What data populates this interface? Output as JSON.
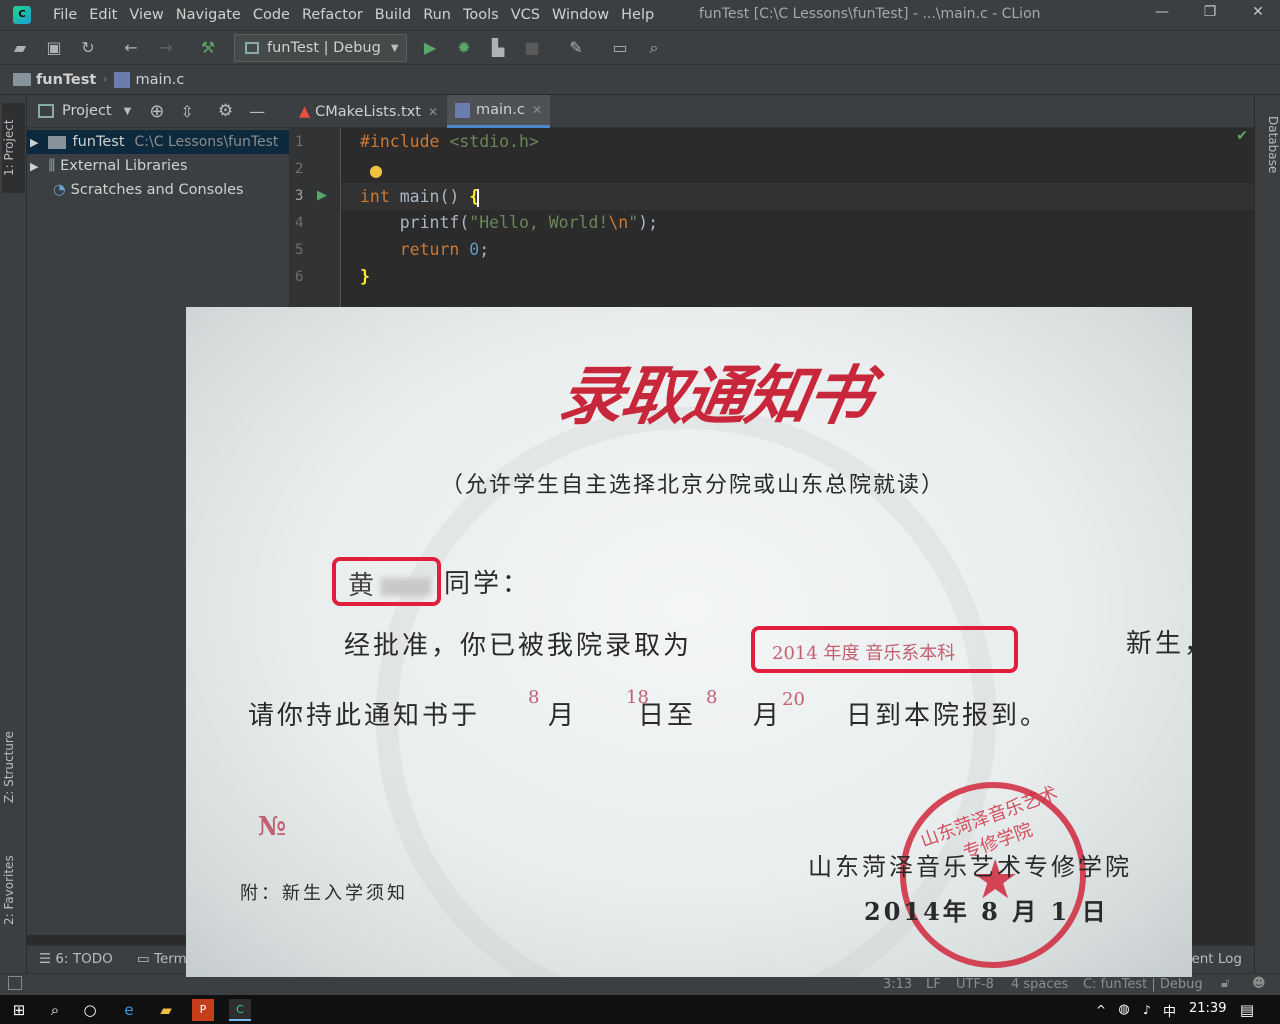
{
  "window": {
    "title": "funTest [C:\\C Lessons\\funTest] - ...\\main.c - CLion",
    "minimize_glyph": "—",
    "restore_glyph": "❐",
    "close_glyph": "✕"
  },
  "menu": [
    "File",
    "Edit",
    "View",
    "Navigate",
    "Code",
    "Refactor",
    "Build",
    "Run",
    "Tools",
    "VCS",
    "Window",
    "Help"
  ],
  "toolbar": {
    "run_config": "funTest | Debug"
  },
  "breadcrumb": {
    "project": "funTest",
    "file": "main.c"
  },
  "project_panel": {
    "view_label": "Project",
    "items": [
      {
        "label": "funTest",
        "path": "C:\\C Lessons\\funTest"
      },
      {
        "label": "External Libraries",
        "path": ""
      },
      {
        "label": "Scratches and Consoles",
        "path": ""
      }
    ]
  },
  "left_tabs": {
    "project": "1: Project",
    "structure": "Z: Structure",
    "favorites": "2: Favorites"
  },
  "right_tabs": {
    "database": "Database"
  },
  "editor": {
    "tabs": [
      {
        "label": "CMakeLists.txt",
        "active": false
      },
      {
        "label": "main.c",
        "active": true
      }
    ],
    "line_numbers": [
      "1",
      "2",
      "3",
      "4",
      "5",
      "6"
    ],
    "code": {
      "l1_directive": "#include",
      "l1_header": "<stdio.h>",
      "l3_type": "int",
      "l3_rest": " main() ",
      "l3_brace": "{",
      "l4_call": "    printf(",
      "l4_str_a": "\"Hello, World!",
      "l4_esc": "\\n",
      "l4_str_b": "\"",
      "l4_end": ");",
      "l5_kw": "    return",
      "l5_sp": " ",
      "l5_num": "0",
      "l5_end": ";",
      "l6_brace": "}"
    }
  },
  "bottom_tools": {
    "todo": "6: TODO",
    "terminal": "Term",
    "event_log": "ent Log"
  },
  "status": {
    "position": "3:13",
    "line_sep": "LF",
    "encoding": "UTF-8",
    "indent": "4 spaces",
    "context": "C: funTest | Debug"
  },
  "taskbar": {
    "ime": "中",
    "time": "21:39"
  },
  "notice": {
    "title": "录取通知书",
    "subtitle": "（允许学生自主选择北京分院或山东总院就读）",
    "name_prefix": "黄",
    "salutation": "同学：",
    "line1": "经批准，你已被我院录取为",
    "admission": "2014 年度  音乐系本科",
    "line1_tail": "新生，",
    "line2": "请你持此通知书于",
    "m1": "8",
    "month_word": "月",
    "d1": "18",
    "day_to": "日至",
    "m2": "8",
    "d2": "20",
    "line2_tail": "日到本院报到。",
    "serial": "№",
    "attachment": "附：新生入学须知",
    "issuer": "山东菏泽音乐艺术专修学院",
    "date": "2014年  8  月  1  日"
  }
}
